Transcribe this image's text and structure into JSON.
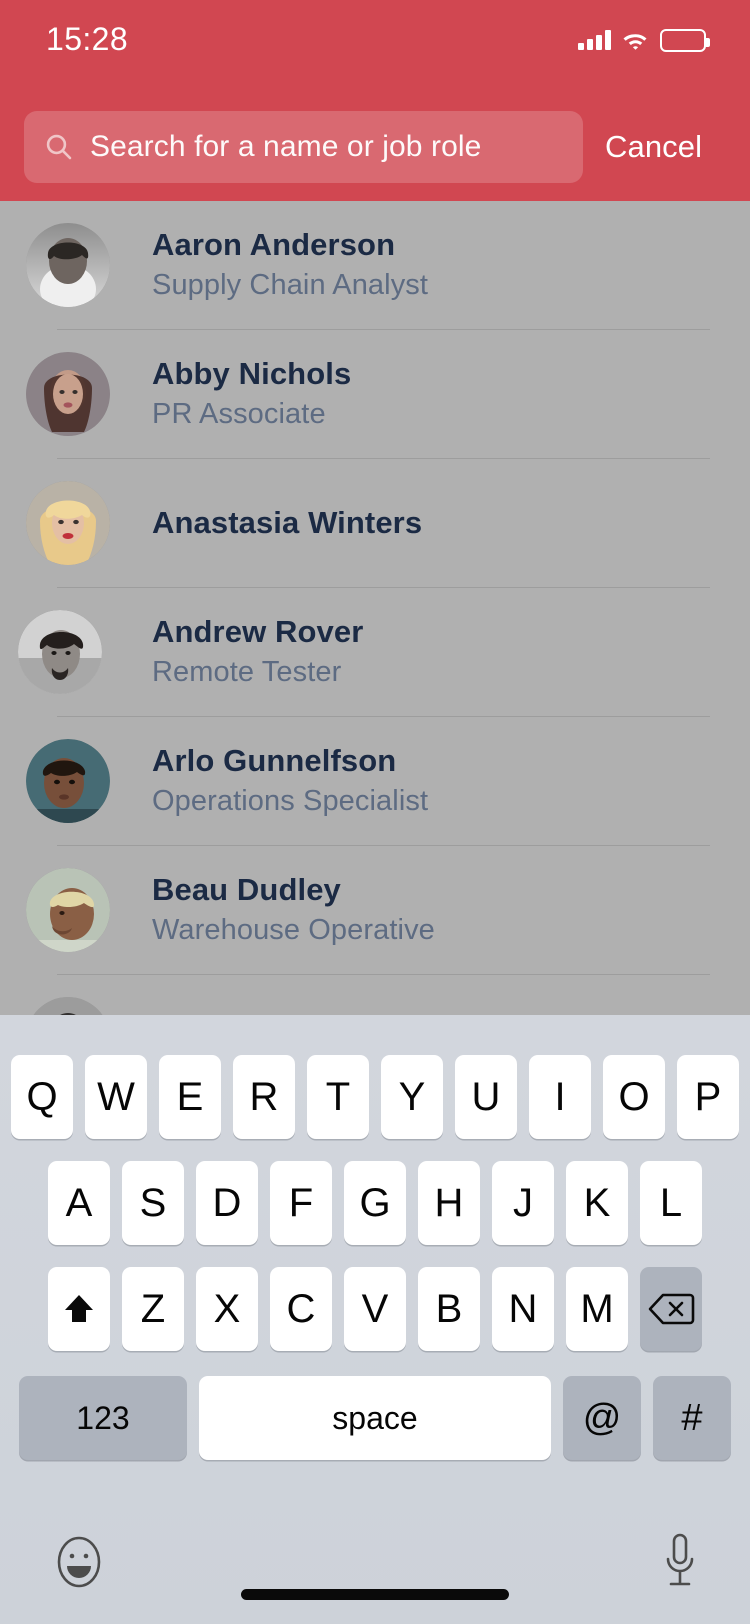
{
  "status_bar": {
    "time": "15:28",
    "signal_icon": "cellular-signal-icon",
    "wifi_icon": "wifi-icon",
    "battery_icon": "battery-full-icon"
  },
  "header": {
    "background_color": "#d14751",
    "search": {
      "icon": "search-icon",
      "value": "",
      "placeholder": "Search for a name or job role"
    },
    "cancel_label": "Cancel"
  },
  "contact_list": {
    "background_color": "#b0b0b0",
    "name_color": "#1b2a44",
    "role_color": "#5d6b82",
    "contacts": [
      {
        "name": "Aaron Anderson",
        "role": "Supply Chain Analyst"
      },
      {
        "name": "Abby Nichols",
        "role": "PR Associate"
      },
      {
        "name": "Anastasia Winters",
        "role": ""
      },
      {
        "name": "Andrew Rover",
        "role": "Remote Tester"
      },
      {
        "name": "Arlo Gunnelfson",
        "role": "Operations Specialist"
      },
      {
        "name": "Beau Dudley",
        "role": "Warehouse Operative"
      }
    ]
  },
  "keyboard": {
    "background_color": "#d0d5dc",
    "key_color": "#ffffff",
    "modifier_key_color": "#adb3bd",
    "row1": [
      "Q",
      "W",
      "E",
      "R",
      "T",
      "Y",
      "U",
      "I",
      "O",
      "P"
    ],
    "row2": [
      "A",
      "S",
      "D",
      "F",
      "G",
      "H",
      "J",
      "K",
      "L"
    ],
    "row3_letters": [
      "Z",
      "X",
      "C",
      "V",
      "B",
      "N",
      "M"
    ],
    "shift_icon": "shift-up-arrow-icon",
    "backspace_icon": "backspace-delete-icon",
    "numbers_label": "123",
    "space_label": "space",
    "at_label": "@",
    "hash_label": "#",
    "emoji_icon": "emoji-smiley-icon",
    "mic_icon": "microphone-icon"
  }
}
